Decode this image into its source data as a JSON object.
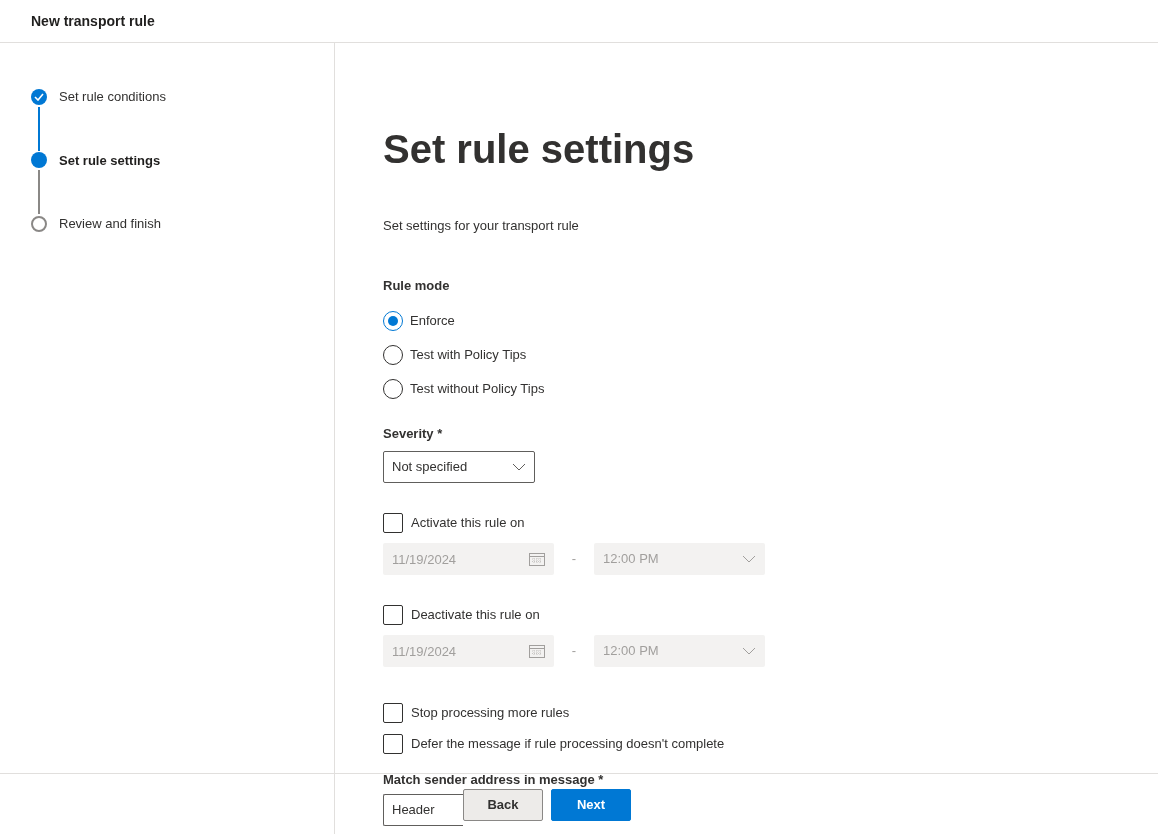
{
  "header": {
    "title": "New transport rule"
  },
  "steps": [
    {
      "label": "Set rule conditions",
      "completed": true,
      "selected": false
    },
    {
      "label": "Set rule settings",
      "completed": false,
      "selected": true
    },
    {
      "label": "Review and finish",
      "completed": false,
      "selected": false
    }
  ],
  "main": {
    "heading": "Set rule settings",
    "description": "Set settings for your transport rule",
    "rule_mode": {
      "label": "Rule mode",
      "options": [
        {
          "label": "Enforce",
          "selected": true
        },
        {
          "label": "Test with Policy Tips",
          "selected": false
        },
        {
          "label": "Test without Policy Tips",
          "selected": false
        }
      ]
    },
    "severity": {
      "label": "Severity *",
      "value": "Not specified"
    },
    "schedules": [
      {
        "label": "Activate this rule on",
        "checked": false,
        "date": "11/19/2024",
        "separator": "-",
        "time": "12:00 PM",
        "disabled": true
      },
      {
        "label": "Deactivate this rule on",
        "checked": false,
        "date": "11/19/2024",
        "separator": "-",
        "time": "12:00 PM",
        "disabled": true
      }
    ],
    "options": [
      {
        "label": "Stop processing more rules",
        "checked": false
      },
      {
        "label": "Defer the message if rule processing doesn't complete",
        "checked": false
      }
    ],
    "match_sender": {
      "label": "Match sender address in message *",
      "value": "Header"
    }
  },
  "footer": {
    "buttons": [
      {
        "label": "Back",
        "kind": "secondary"
      },
      {
        "label": "Next",
        "kind": "primary"
      }
    ]
  }
}
